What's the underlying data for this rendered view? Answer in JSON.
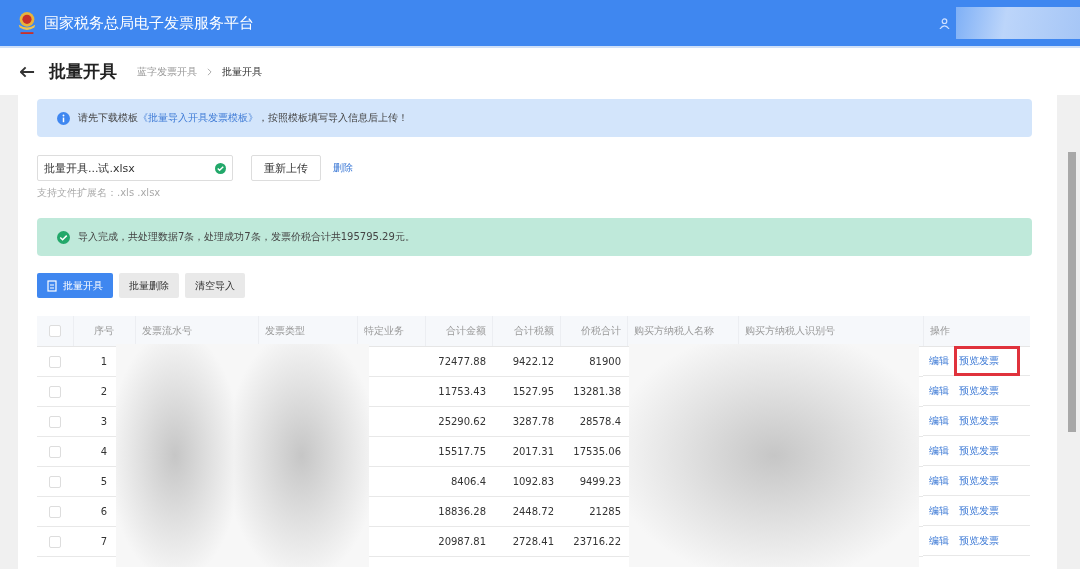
{
  "header": {
    "title": "国家税务总局电子发票服务平台"
  },
  "page": {
    "title": "批量开具",
    "breadcrumb": [
      {
        "label": "蓝字发票开具",
        "current": false
      },
      {
        "label": "批量开具",
        "current": true
      }
    ]
  },
  "notice": {
    "before": "请先下载模板",
    "link": "《批量导入开具发票模板》",
    "after": "，按照模板填写导入信息后上传！"
  },
  "upload": {
    "file_name": "批量开具...试.xlsx",
    "uploaded": true,
    "reupload": "重新上传",
    "delete": "删除",
    "hint": "支持文件扩展名：.xls .xlsx"
  },
  "result": {
    "text": "导入完成，共处理数据7条，处理成功7条，发票价税合计共195795.29元。"
  },
  "actions": [
    {
      "label": "批量开具",
      "primary": true
    },
    {
      "label": "批量删除",
      "primary": false
    },
    {
      "label": "清空导入",
      "primary": false
    }
  ],
  "table": {
    "all_checked": false,
    "columns": [
      "序号",
      "发票流水号",
      "发票类型",
      "特定业务",
      "合计金额",
      "合计税额",
      "价税合计",
      "购买方纳税人名称",
      "购买方纳税人识别号",
      "操作"
    ],
    "rows": [
      {
        "checked": false,
        "no": "1",
        "amount": "72477.88",
        "tax": "9422.12",
        "total": "81900",
        "edit": "编辑",
        "preview": "预览发票",
        "highlighted": true
      },
      {
        "checked": false,
        "no": "2",
        "amount": "11753.43",
        "tax": "1527.95",
        "total": "13281.38",
        "edit": "编辑",
        "preview": "预览发票",
        "highlighted": false
      },
      {
        "checked": false,
        "no": "3",
        "amount": "25290.62",
        "tax": "3287.78",
        "total": "28578.4",
        "edit": "编辑",
        "preview": "预览发票",
        "highlighted": false
      },
      {
        "checked": false,
        "no": "4",
        "amount": "15517.75",
        "tax": "2017.31",
        "total": "17535.06",
        "edit": "编辑",
        "preview": "预览发票",
        "highlighted": false
      },
      {
        "checked": false,
        "no": "5",
        "amount": "8406.4",
        "tax": "1092.83",
        "total": "9499.23",
        "edit": "编辑",
        "preview": "预览发票",
        "highlighted": false
      },
      {
        "checked": false,
        "no": "6",
        "amount": "18836.28",
        "tax": "2448.72",
        "total": "21285",
        "edit": "编辑",
        "preview": "预览发票",
        "highlighted": false
      },
      {
        "checked": false,
        "no": "7",
        "amount": "20987.81",
        "tax": "2728.41",
        "total": "23716.22",
        "edit": "编辑",
        "preview": "预览发票",
        "highlighted": false
      }
    ]
  }
}
